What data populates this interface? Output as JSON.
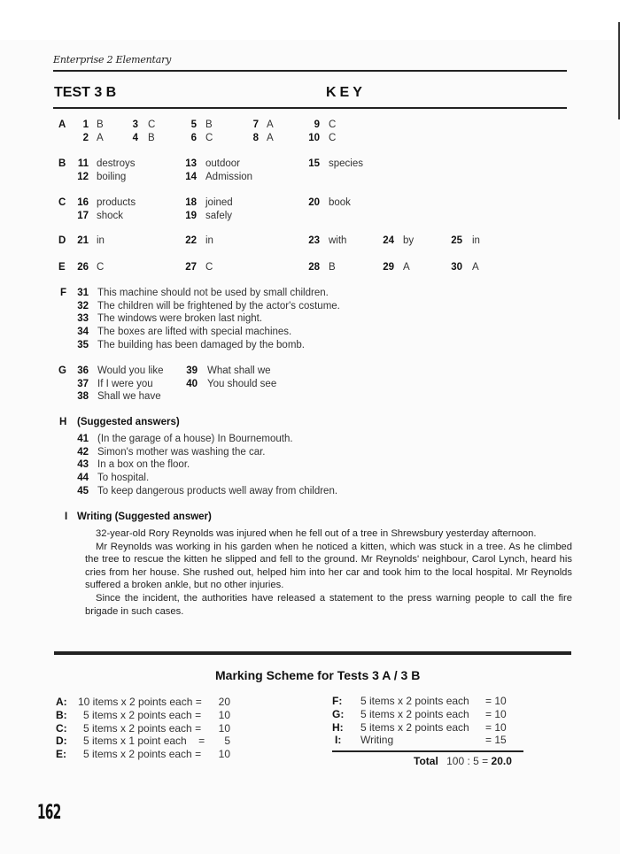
{
  "header": {
    "running_title": "Enterprise 2 Elementary",
    "test_title": "TEST 3 B",
    "key_label": "KEY"
  },
  "sections": {
    "A": {
      "label": "A",
      "items": [
        {
          "n": "1",
          "a": "B"
        },
        {
          "n": "2",
          "a": "A"
        },
        {
          "n": "3",
          "a": "C"
        },
        {
          "n": "4",
          "a": "B"
        },
        {
          "n": "5",
          "a": "B"
        },
        {
          "n": "6",
          "a": "C"
        },
        {
          "n": "7",
          "a": "A"
        },
        {
          "n": "8",
          "a": "A"
        },
        {
          "n": "9",
          "a": "C"
        },
        {
          "n": "10",
          "a": "C"
        }
      ]
    },
    "B": {
      "label": "B",
      "items": [
        {
          "n": "11",
          "a": "destroys"
        },
        {
          "n": "12",
          "a": "boiling"
        },
        {
          "n": "13",
          "a": "outdoor"
        },
        {
          "n": "14",
          "a": "Admission"
        },
        {
          "n": "15",
          "a": "species"
        }
      ]
    },
    "C": {
      "label": "C",
      "items": [
        {
          "n": "16",
          "a": "products"
        },
        {
          "n": "17",
          "a": "shock"
        },
        {
          "n": "18",
          "a": "joined"
        },
        {
          "n": "19",
          "a": "safely"
        },
        {
          "n": "20",
          "a": "book"
        }
      ]
    },
    "D": {
      "label": "D",
      "items": [
        {
          "n": "21",
          "a": "in"
        },
        {
          "n": "22",
          "a": "in"
        },
        {
          "n": "23",
          "a": "with"
        },
        {
          "n": "24",
          "a": "by"
        },
        {
          "n": "25",
          "a": "in"
        }
      ]
    },
    "E": {
      "label": "E",
      "items": [
        {
          "n": "26",
          "a": "C"
        },
        {
          "n": "27",
          "a": "C"
        },
        {
          "n": "28",
          "a": "B"
        },
        {
          "n": "29",
          "a": "A"
        },
        {
          "n": "30",
          "a": "A"
        }
      ]
    },
    "F": {
      "label": "F",
      "items": [
        {
          "n": "31",
          "a": "This machine should not be used by small children."
        },
        {
          "n": "32",
          "a": "The children will be frightened by the actor's costume."
        },
        {
          "n": "33",
          "a": "The windows were broken last night."
        },
        {
          "n": "34",
          "a": "The boxes are lifted with special machines."
        },
        {
          "n": "35",
          "a": "The building has been damaged by the bomb."
        }
      ]
    },
    "G": {
      "label": "G",
      "items": [
        {
          "n": "36",
          "a": "Would you like"
        },
        {
          "n": "37",
          "a": "If I were you"
        },
        {
          "n": "38",
          "a": "Shall we have"
        },
        {
          "n": "39",
          "a": "What shall we"
        },
        {
          "n": "40",
          "a": "You should see"
        }
      ]
    },
    "H": {
      "label": "H",
      "heading": "(Suggested answers)",
      "items": [
        {
          "n": "41",
          "a": "(In the garage of a house) In Bournemouth."
        },
        {
          "n": "42",
          "a": "Simon's mother was washing the car."
        },
        {
          "n": "43",
          "a": "In a box on the floor."
        },
        {
          "n": "44",
          "a": "To hospital."
        },
        {
          "n": "45",
          "a": "To keep dangerous products well away from children."
        }
      ]
    },
    "I": {
      "label": "I",
      "heading": "Writing (Suggested answer)",
      "paragraphs": [
        "32-year-old Rory Reynolds was injured when he fell out of a tree in Shrewsbury yesterday afternoon.",
        "Mr Reynolds was working in his garden when he noticed a kitten, which was stuck in a tree. As he climbed the tree to rescue the kitten he slipped and fell to the ground. Mr Reynolds' neighbour, Carol Lynch, heard his cries from her house. She rushed out, helped him into her car and took him to the local hospital. Mr Reynolds suffered a broken ankle, but no other injuries.",
        "Since the incident, the authorities have released a statement to the press warning people to call the fire brigade in such cases."
      ]
    }
  },
  "marking_scheme": {
    "title": "Marking Scheme for Tests 3 A / 3 B",
    "left": [
      {
        "letter": "A:",
        "text": "10 items x 2 points each =",
        "points": "20"
      },
      {
        "letter": "B:",
        "text": "5 items x 2 points each =",
        "points": "10"
      },
      {
        "letter": "C:",
        "text": "5 items x 2 points each =",
        "points": "10"
      },
      {
        "letter": "D:",
        "text": "5 items x 1 point each    =",
        "points": "5"
      },
      {
        "letter": "E:",
        "text": "5 items x 2 points each =",
        "points": "10"
      }
    ],
    "right": [
      {
        "letter": "F:",
        "text": "5 items x 2 points each",
        "points": "= 10"
      },
      {
        "letter": "G:",
        "text": "5 items x 2 points each",
        "points": "= 10"
      },
      {
        "letter": "H:",
        "text": "5 items x 2 points each",
        "points": "= 10"
      },
      {
        "letter": "I:",
        "text": "Writing",
        "points": "= 15"
      }
    ],
    "total_label": "Total",
    "total_calc": "100 : 5 =",
    "total_value": "20.0"
  },
  "footer": {
    "page_number": "162"
  }
}
